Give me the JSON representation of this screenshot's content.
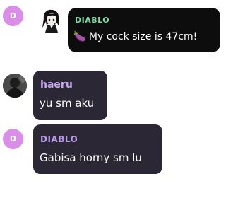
{
  "colors": {
    "bubble": "#2b2735",
    "bubble_dark": "#0d0d0d",
    "name_diablo_top": "#7fd9a4",
    "name_haeru": "#c8a6f0",
    "name_diablo": "#b79ae8",
    "avatar_letter_bg": "#d98ee8"
  },
  "messages": [
    {
      "avatar_letter": "D",
      "sticker_icon": "anime-girl-sticker-icon",
      "name": "DIABLO",
      "emoji": "🍆",
      "text": "My cock size is 47cm!"
    },
    {
      "avatar_icon": "user-photo-avatar-icon",
      "name": "haeru",
      "text": "yu sm aku"
    },
    {
      "avatar_letter": "D",
      "name": "DIABLO",
      "text": "Gabisa horny sm lu"
    }
  ]
}
